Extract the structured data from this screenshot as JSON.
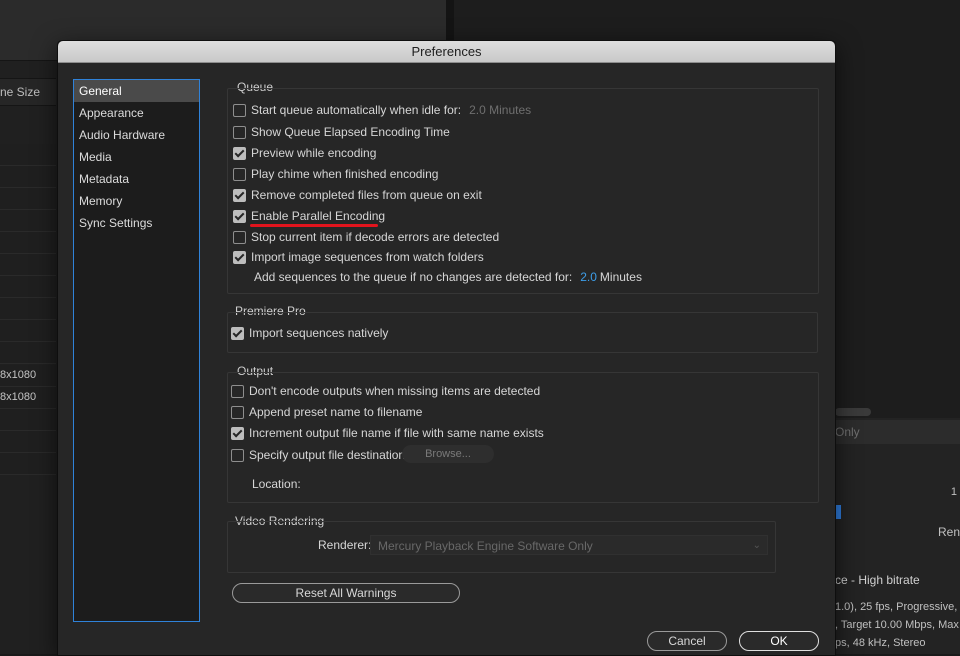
{
  "background": {
    "column_header": "ne Size",
    "rows": [
      "8x1080",
      "8x1080"
    ],
    "right_texts": {
      "only": "Only",
      "num": "1",
      "ren": "Ren",
      "preset": "ce - High bitrate",
      "line1": "1.0), 25 fps, Progressive, Se",
      "line2": ", Target 10.00 Mbps, Max",
      "line3": "ps, 48 kHz, Stereo"
    }
  },
  "dialog": {
    "title": "Preferences",
    "sidebar": [
      "General",
      "Appearance",
      "Audio Hardware",
      "Media",
      "Metadata",
      "Memory",
      "Sync Settings"
    ],
    "selected_sidebar": "General",
    "queue": {
      "title": "Queue",
      "items": [
        {
          "label": "Start queue automatically when idle for:",
          "checked": false,
          "suffix": "2.0 Minutes"
        },
        {
          "label": "Show Queue Elapsed Encoding Time",
          "checked": false
        },
        {
          "label": "Preview while encoding",
          "checked": true
        },
        {
          "label": "Play chime when finished encoding",
          "checked": false
        },
        {
          "label": "Remove completed files from queue on exit",
          "checked": true
        },
        {
          "label": "Enable Parallel Encoding",
          "checked": true
        },
        {
          "label": "Stop current item if decode errors are detected",
          "checked": false
        },
        {
          "label": "Import image sequences from watch folders",
          "checked": true
        }
      ],
      "add_sequences_label": "Add sequences to the queue if no changes are detected for:",
      "add_sequences_value": "2.0",
      "add_sequences_unit": "Minutes"
    },
    "premiere": {
      "title": "Premiere Pro",
      "items": [
        {
          "label": "Import sequences natively",
          "checked": true
        }
      ]
    },
    "output": {
      "title": "Output",
      "items": [
        {
          "label": "Don't encode outputs when missing items are detected",
          "checked": false
        },
        {
          "label": "Append preset name to filename",
          "checked": false
        },
        {
          "label": "Increment output file name if file with same name exists",
          "checked": true
        },
        {
          "label": "Specify output file destination:",
          "checked": false
        }
      ],
      "browse_label": "Browse...",
      "location_label": "Location:"
    },
    "video_rendering": {
      "title": "Video Rendering",
      "renderer_label": "Renderer:",
      "renderer_value": "Mercury Playback Engine Software Only"
    },
    "reset_label": "Reset All Warnings",
    "cancel_label": "Cancel",
    "ok_label": "OK",
    "highlight_color": "#e2141d",
    "accent_color": "#2f82d9"
  }
}
